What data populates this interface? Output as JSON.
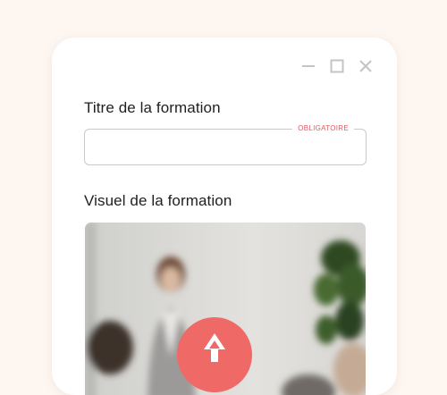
{
  "form": {
    "title_label": "Titre de la formation",
    "title_value": "",
    "required_tag": "OBLIGATOIRE",
    "visual_label": "Visuel de la formation"
  },
  "window": {
    "icons": [
      "minimize-icon",
      "maximize-icon",
      "close-icon"
    ]
  },
  "colors": {
    "background": "#fdf6f1",
    "card": "#ffffff",
    "accent": "#ef6a66",
    "required": "#e2585f",
    "border": "#c9c9c9"
  },
  "visual": {
    "icon": "upload-arrow-icon"
  }
}
